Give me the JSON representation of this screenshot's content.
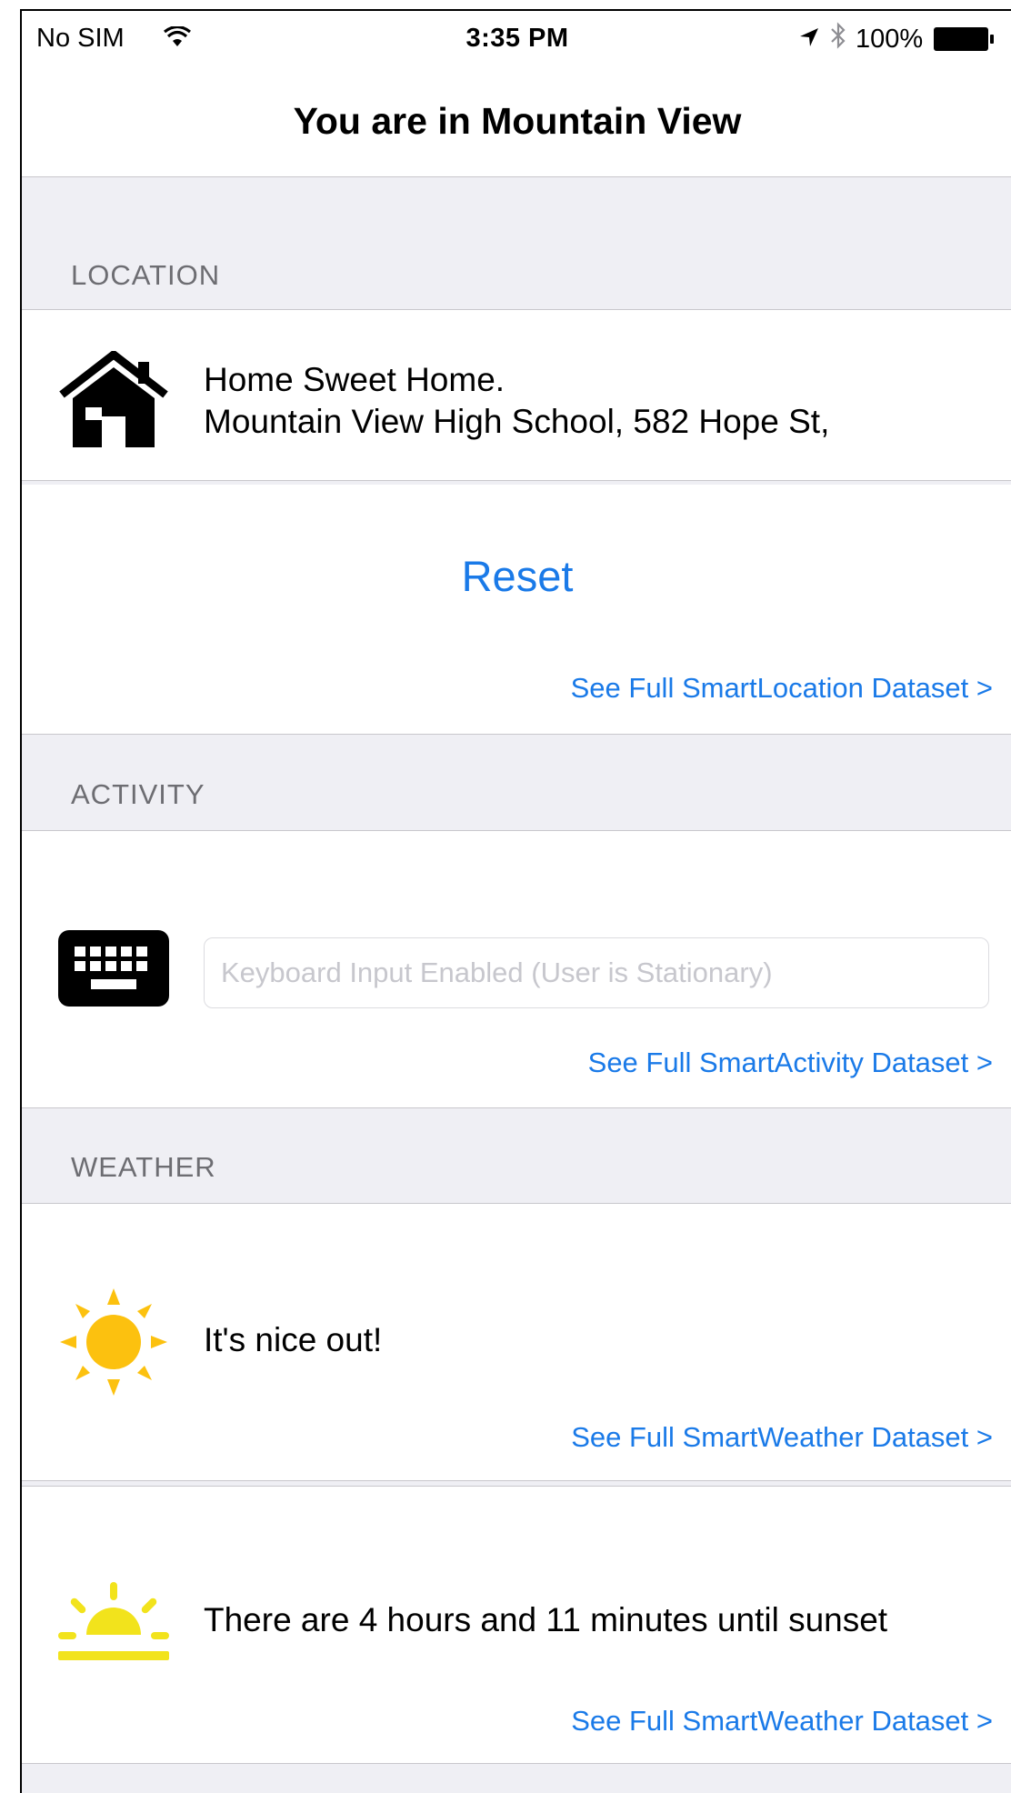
{
  "status_bar": {
    "carrier": "No SIM",
    "time": "3:35 PM",
    "battery": "100%",
    "icons": [
      "wifi-icon",
      "location-arrow-icon",
      "bluetooth-icon",
      "battery-icon"
    ]
  },
  "nav": {
    "title": "You are in Mountain View"
  },
  "location": {
    "header": "LOCATION",
    "icon": "home-icon",
    "line1": "Home Sweet Home.",
    "line2": "Mountain View High School, 582 Hope St,",
    "reset_label": "Reset",
    "link": "See Full SmartLocation Dataset >"
  },
  "activity": {
    "header": "ACTIVITY",
    "icon": "keyboard-icon",
    "input_placeholder": "Keyboard Input Enabled (User is Stationary)",
    "input_value": "",
    "link": "See Full SmartActivity Dataset >"
  },
  "weather": {
    "header": "WEATHER",
    "icon": "sun-icon",
    "text": "It's nice out!",
    "link": "See Full SmartWeather Dataset >"
  },
  "sunset": {
    "icon": "sunset-icon",
    "text": "There are 4 hours and 11 minutes until sunset",
    "link": "See Full SmartWeather Dataset >"
  },
  "colors": {
    "link": "#1a7ae8",
    "section_bg": "#efeff4",
    "section_text": "#6d6d72",
    "sun": "#fcc10f",
    "sunset": "#f2e31c"
  }
}
